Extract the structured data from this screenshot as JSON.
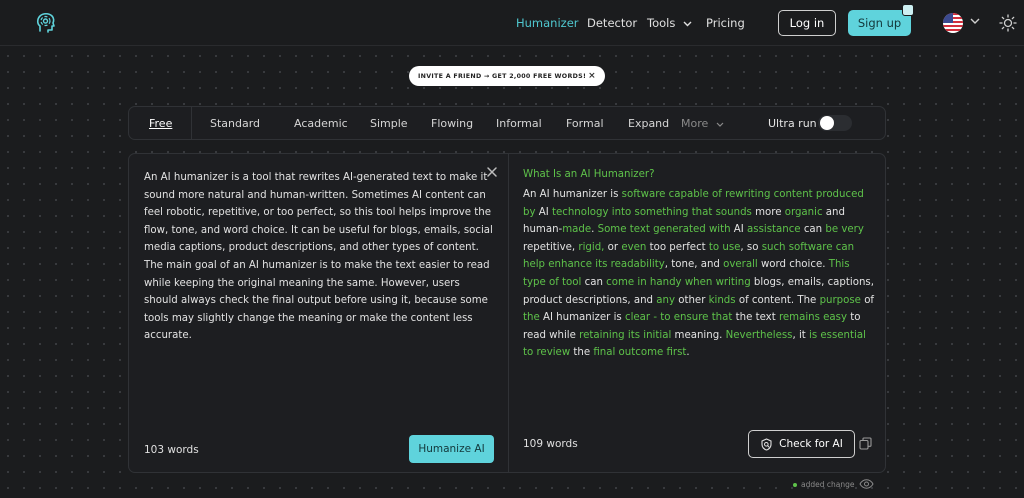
{
  "nav": {
    "links": [
      "Humanizer",
      "Detector",
      "Tools",
      "Pricing"
    ],
    "login": "Log in",
    "signup": "Sign up"
  },
  "invite": {
    "text": "INVITE A FRIEND → GET 2,000 FREE WORDS!",
    "close": "×"
  },
  "modes": {
    "items": [
      "Free",
      "Standard",
      "Academic",
      "Simple",
      "Flowing",
      "Informal",
      "Formal",
      "Expand"
    ],
    "more": "More",
    "active": "Free",
    "ultra_label": "Ultra run",
    "ultra_on": false
  },
  "input": {
    "text": "An AI humanizer is a tool that rewrites AI-generated text to make it sound more natural and human-written. Sometimes AI content can feel robotic, repetitive, or too perfect, so this tool helps improve the flow, tone, and word choice. It can be useful for blogs, emails, social media captions, product descriptions, and other types of content. The main goal of an AI humanizer is to make the text easier to read while keeping the original meaning the same. However, users should always check the final output before using it, because some tools may slightly change the meaning or make the content less accurate.",
    "word_count": "103 words",
    "button": "Humanize AI"
  },
  "output": {
    "title": "What Is an AI Humanizer?",
    "segments": [
      {
        "t": "An AI humanizer is ",
        "c": false
      },
      {
        "t": "software capable of rewriting content produced by",
        "c": true
      },
      {
        "t": " AI ",
        "c": false
      },
      {
        "t": "technology into something that sounds",
        "c": true
      },
      {
        "t": " more ",
        "c": false
      },
      {
        "t": "organic",
        "c": true
      },
      {
        "t": " and human-",
        "c": false
      },
      {
        "t": "made",
        "c": true
      },
      {
        "t": ". ",
        "c": false
      },
      {
        "t": "Some text generated with",
        "c": true
      },
      {
        "t": " AI ",
        "c": false
      },
      {
        "t": "assistance",
        "c": true
      },
      {
        "t": " can ",
        "c": false
      },
      {
        "t": "be very",
        "c": true
      },
      {
        "t": " repetitive, ",
        "c": false
      },
      {
        "t": "rigid,",
        "c": true
      },
      {
        "t": " or ",
        "c": false
      },
      {
        "t": "even",
        "c": true
      },
      {
        "t": " too perfect ",
        "c": false
      },
      {
        "t": "to use",
        "c": true
      },
      {
        "t": ", so ",
        "c": false
      },
      {
        "t": "such software can help enhance its readability",
        "c": true
      },
      {
        "t": ", tone, and ",
        "c": false
      },
      {
        "t": "overall",
        "c": true
      },
      {
        "t": " word choice. ",
        "c": false
      },
      {
        "t": "This type of tool",
        "c": true
      },
      {
        "t": " can ",
        "c": false
      },
      {
        "t": "come in handy when writing",
        "c": true
      },
      {
        "t": " blogs, emails, captions, product descriptions, and ",
        "c": false
      },
      {
        "t": "any",
        "c": true
      },
      {
        "t": " other ",
        "c": false
      },
      {
        "t": "kinds",
        "c": true
      },
      {
        "t": " of content. The ",
        "c": false
      },
      {
        "t": "purpose",
        "c": true
      },
      {
        "t": " of ",
        "c": false
      },
      {
        "t": "the",
        "c": true
      },
      {
        "t": " AI humanizer is ",
        "c": false
      },
      {
        "t": "clear - to ensure that",
        "c": true
      },
      {
        "t": " the text ",
        "c": false
      },
      {
        "t": "remains easy",
        "c": true
      },
      {
        "t": " to read while ",
        "c": false
      },
      {
        "t": "retaining its initial",
        "c": true
      },
      {
        "t": " meaning. ",
        "c": false
      },
      {
        "t": "Nevertheless",
        "c": true
      },
      {
        "t": ", it ",
        "c": false
      },
      {
        "t": "is essential to review",
        "c": true
      },
      {
        "t": " the ",
        "c": false
      },
      {
        "t": "final outcome first",
        "c": true
      },
      {
        "t": ".",
        "c": false
      }
    ],
    "word_count": "109 words",
    "check_button": "Check for AI"
  },
  "legend": {
    "label": "added change"
  },
  "colors": {
    "accent": "#5fd3dc",
    "change": "#5ec24a"
  }
}
